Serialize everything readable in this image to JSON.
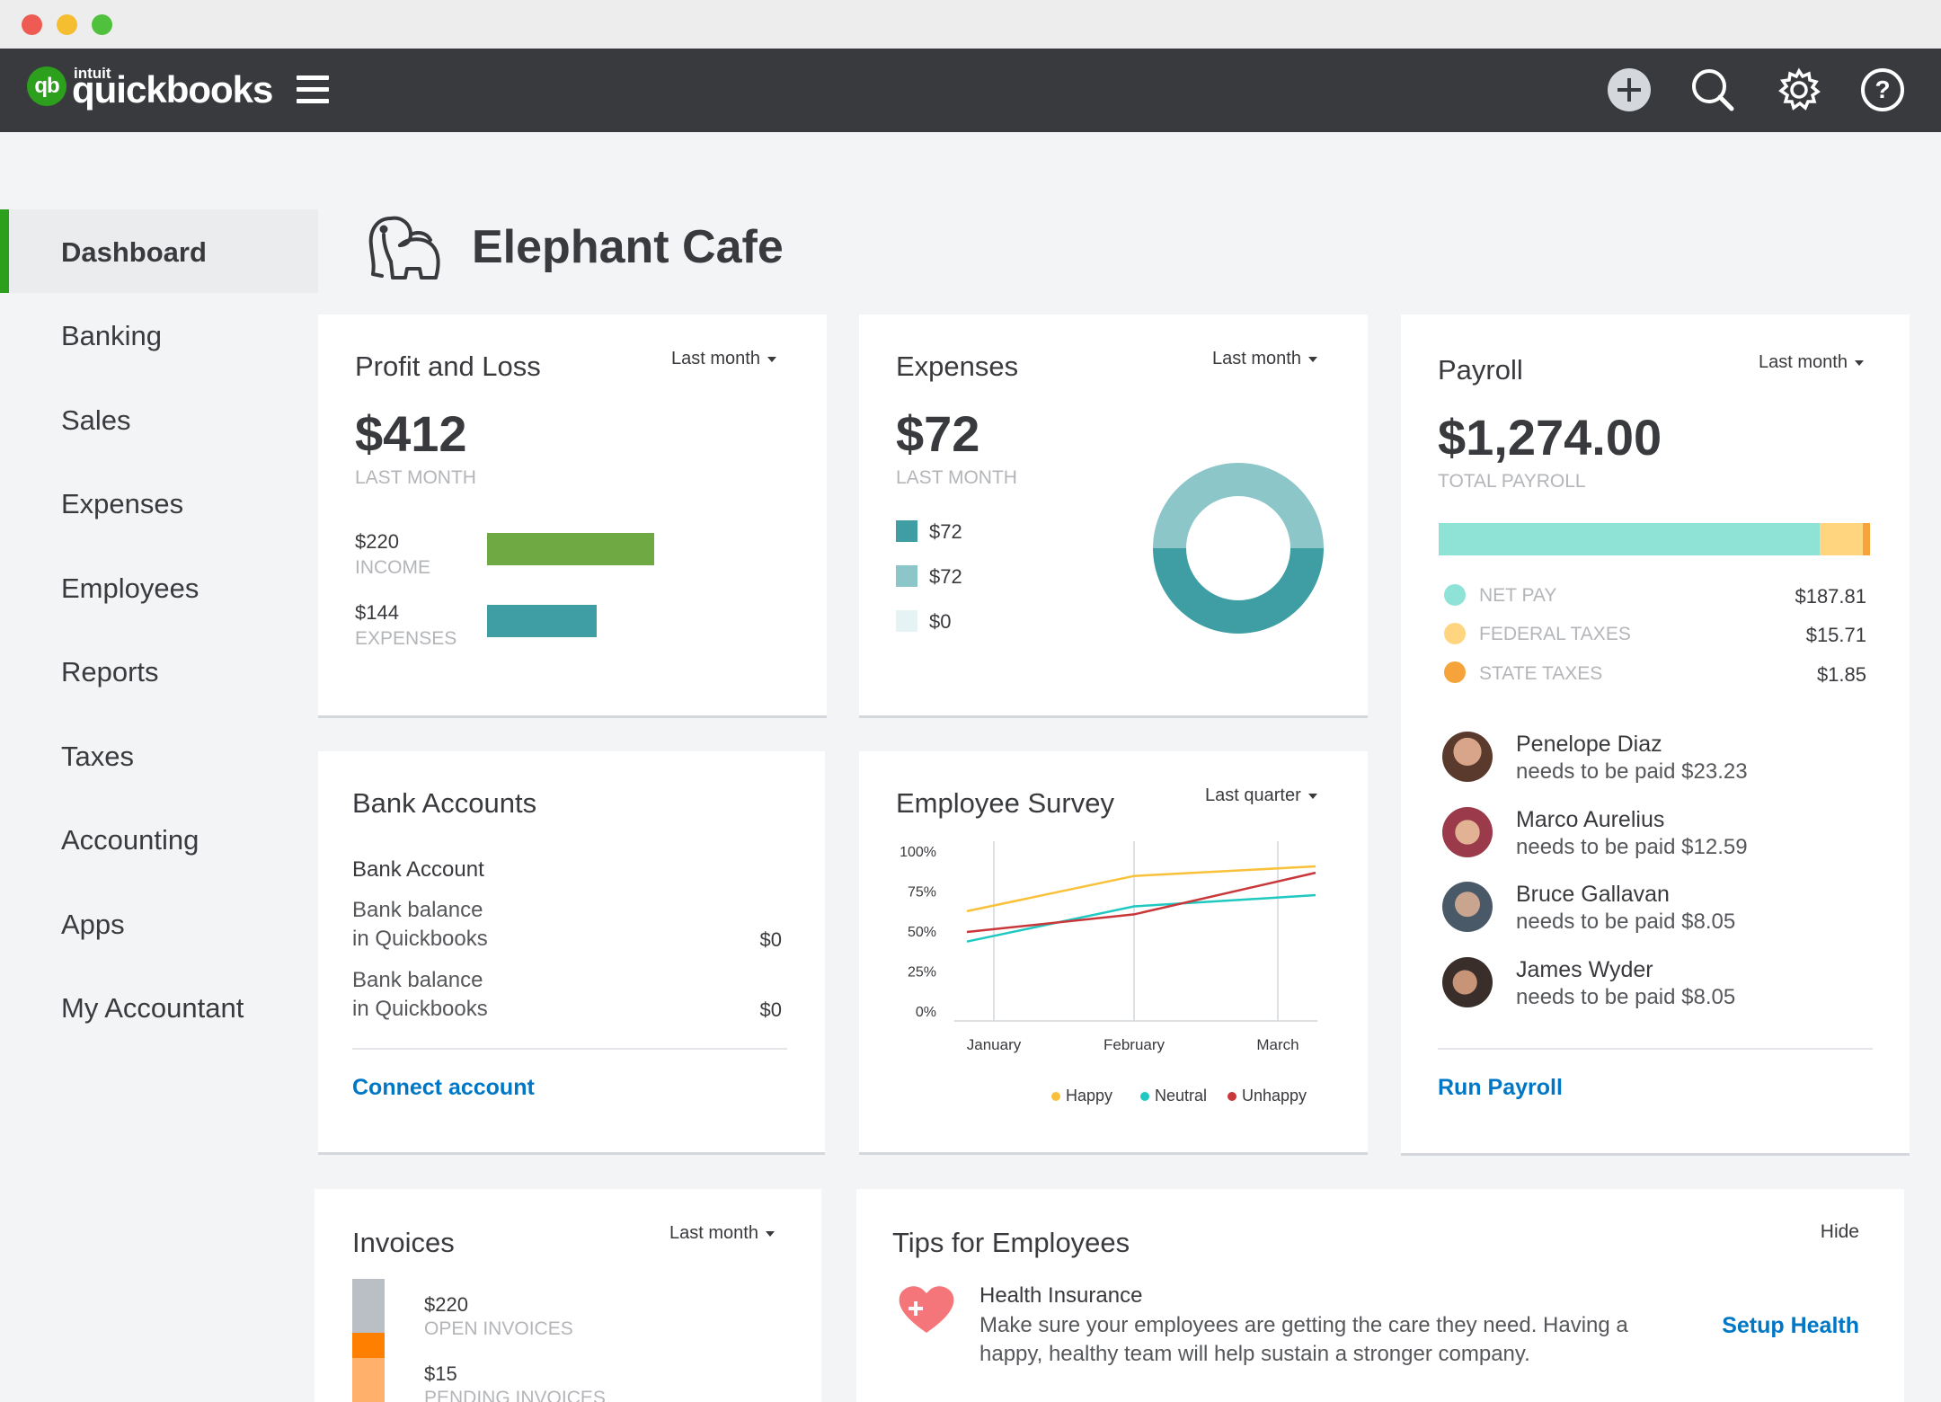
{
  "colors": {
    "brand_green": "#2ca01c",
    "topbar": "#393a3d",
    "income_bar": "#6ea944",
    "expenses_bar": "#3e9ea3",
    "teal_dark": "#3e9ea3",
    "teal_light": "#8dc6c9",
    "teal_pale": "#e6f3f4",
    "net_pay": "#8ee3d6",
    "federal": "#ffd67f",
    "state": "#f7a33b",
    "link": "#0077c5"
  },
  "header": {
    "brand_small": "intuit",
    "brand": "quickbooks",
    "icons": [
      "add-icon",
      "search-icon",
      "gear-icon",
      "help-icon"
    ]
  },
  "sidebar": {
    "items": [
      {
        "label": "Dashboard",
        "active": true
      },
      {
        "label": "Banking"
      },
      {
        "label": "Sales"
      },
      {
        "label": "Expenses"
      },
      {
        "label": "Employees"
      },
      {
        "label": "Reports"
      },
      {
        "label": "Taxes"
      },
      {
        "label": "Accounting"
      },
      {
        "label": "Apps"
      },
      {
        "label": "My Accountant"
      }
    ]
  },
  "company": {
    "name": "Elephant Cafe",
    "logo_icon": "elephant-icon"
  },
  "profit_loss": {
    "title": "Profit and Loss",
    "period": "Last month",
    "amount": "$412",
    "sub": "LAST MONTH",
    "income_amount": "$220",
    "income_label": "INCOME",
    "income_value": 220,
    "expenses_amount": "$144",
    "expenses_label": "EXPENSES",
    "expenses_value": 144
  },
  "expenses": {
    "title": "Expenses",
    "period": "Last month",
    "amount": "$72",
    "sub": "LAST MONTH",
    "legend": [
      "$72",
      "$72",
      "$0"
    ]
  },
  "payroll": {
    "title": "Payroll",
    "period": "Last month",
    "amount": "$1,274.00",
    "sub": "TOTAL PAYROLL",
    "bar_fractions": [
      0.88,
      0.1,
      0.015
    ],
    "breakdown": [
      {
        "label": "NET PAY",
        "value": "$187.81"
      },
      {
        "label": "FEDERAL TAXES",
        "value": "$15.71"
      },
      {
        "label": "STATE TAXES",
        "value": "$1.85"
      }
    ],
    "employees": [
      {
        "name": "Penelope Diaz",
        "sub": "needs to be paid $23.23"
      },
      {
        "name": "Marco Aurelius",
        "sub": "needs to be paid $12.59"
      },
      {
        "name": "Bruce Gallavan",
        "sub": "needs to be paid $8.05"
      },
      {
        "name": "James Wyder",
        "sub": "needs to be paid $8.05"
      }
    ],
    "action": "Run Payroll"
  },
  "bank": {
    "title": "Bank Accounts",
    "account_name": "Bank Account",
    "rows": [
      {
        "line1": "Bank balance",
        "line2": "in Quickbooks",
        "value": "$0"
      },
      {
        "line1": "Bank balance",
        "line2": "in Quickbooks",
        "value": "$0"
      }
    ],
    "action": "Connect account"
  },
  "survey": {
    "title": "Employee Survey",
    "period": "Last quarter"
  },
  "chart_data": {
    "type": "line",
    "title": "Employee Survey",
    "categories": [
      "January",
      "February",
      "March"
    ],
    "y_ticks": [
      "100%",
      "75%",
      "50%",
      "25%",
      "0%"
    ],
    "ylim": [
      0,
      100
    ],
    "grid": "vertical",
    "legend_position": "bottom",
    "series": [
      {
        "name": "Happy",
        "color": "#f9c13a",
        "values": [
          63,
          85,
          91
        ]
      },
      {
        "name": "Neutral",
        "color": "#1fc9c1",
        "values": [
          44,
          66,
          73
        ]
      },
      {
        "name": "Unhappy",
        "color": "#c9373a",
        "values": [
          50,
          61,
          87
        ]
      }
    ]
  },
  "invoices": {
    "title": "Invoices",
    "period": "Last month",
    "open_amount": "$220",
    "open_label": "OPEN INVOICES",
    "pending_amount": "$15",
    "pending_label": "PENDING INVOICES"
  },
  "tips": {
    "title": "Tips for Employees",
    "hide": "Hide",
    "heading": "Health Insurance",
    "line1": "Make sure your employees are getting the care they need. Having a",
    "line2": "happy, healthy team will help sustain a stronger company.",
    "action": "Setup Health"
  }
}
